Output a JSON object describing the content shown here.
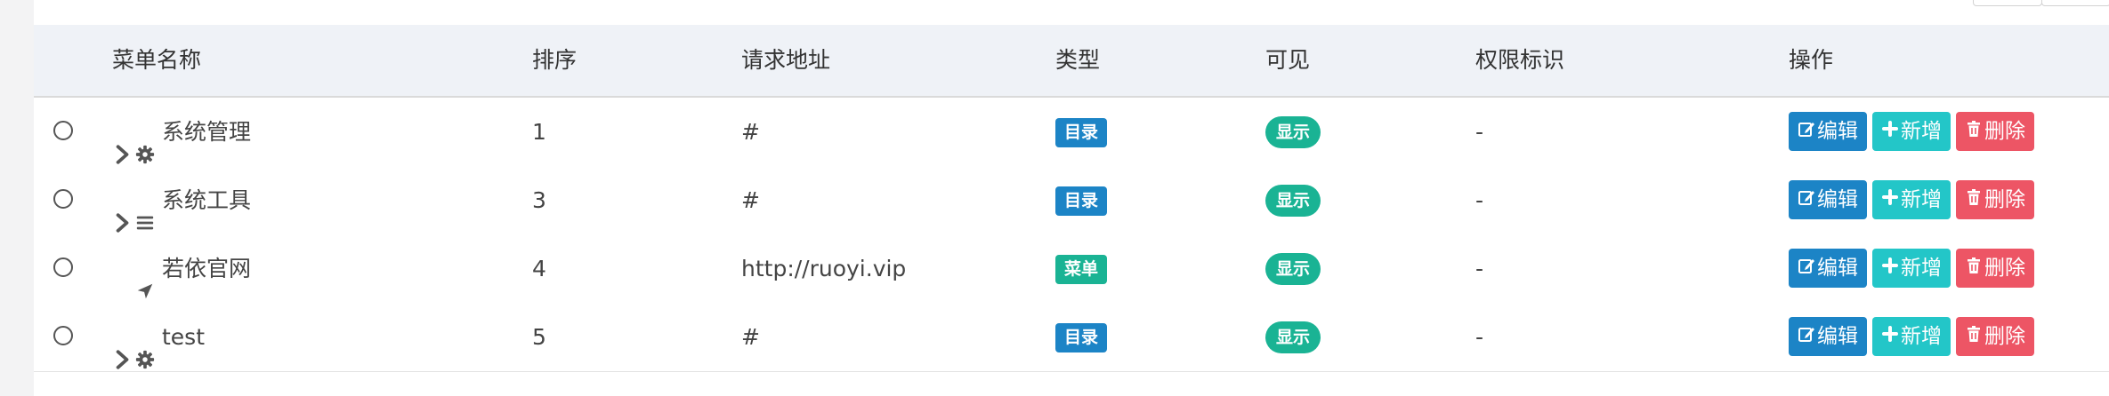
{
  "columns": {
    "name": "菜单名称",
    "order": "排序",
    "url": "请求地址",
    "type": "类型",
    "visible": "可见",
    "perms": "权限标识",
    "actions": "操作"
  },
  "rows": [
    {
      "expander": "chevron-right-icon",
      "icon": "gear-icon",
      "name": "系统管理",
      "order": "1",
      "url": "#",
      "type": "目录",
      "type_color": "#1c84c6",
      "visible": "显示",
      "perms": "-"
    },
    {
      "expander": "chevron-right-icon",
      "icon": "bars-icon",
      "name": "系统工具",
      "order": "3",
      "url": "#",
      "type": "目录",
      "type_color": "#1c84c6",
      "visible": "显示",
      "perms": "-"
    },
    {
      "expander": "",
      "icon": "location-arrow-icon",
      "name": "若依官网",
      "order": "4",
      "url": "http://ruoyi.vip",
      "type": "菜单",
      "type_color": "#1ab394",
      "visible": "显示",
      "perms": "-"
    },
    {
      "expander": "chevron-right-icon",
      "icon": "gear-icon",
      "name": "test",
      "order": "5",
      "url": "#",
      "type": "目录",
      "type_color": "#1c84c6",
      "visible": "显示",
      "perms": "-"
    }
  ],
  "actions": {
    "edit": "编辑",
    "add": "新增",
    "delete": "删除"
  },
  "colors": {
    "edit": "#1c84c6",
    "add": "#23c6c8",
    "delete": "#ed5565",
    "visible": "#1ab394"
  }
}
